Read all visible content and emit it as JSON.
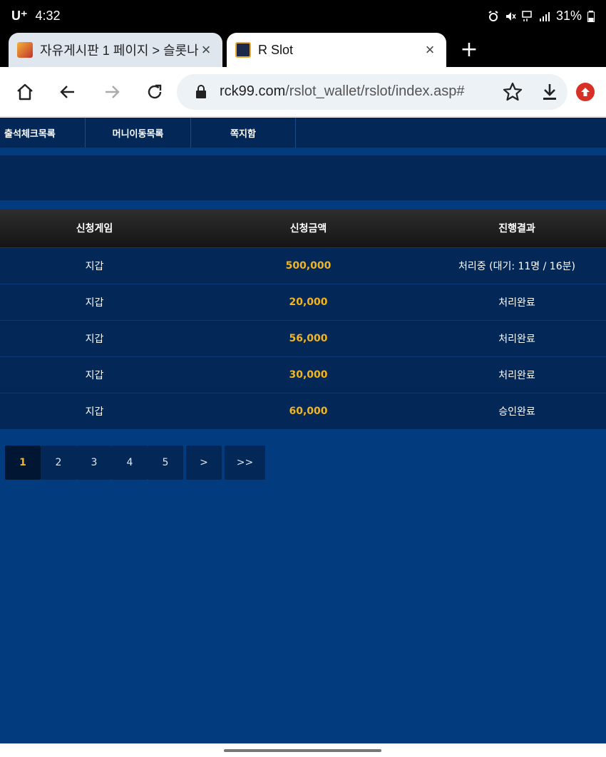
{
  "status": {
    "carrier": "U⁺",
    "time": "4:32",
    "battery": "31%"
  },
  "tabs": [
    {
      "title": "자유게시판 1 페이지 > 슬롯나라",
      "active": false
    },
    {
      "title": "R Slot",
      "active": true
    }
  ],
  "toolbar": {
    "url_host": "rck99.com",
    "url_path": "/rslot_wallet/rslot/index.asp#"
  },
  "subnav": [
    "출석체크목록",
    "머니이동목록",
    "쪽지함"
  ],
  "table": {
    "headers": [
      "신청게임",
      "신청금액",
      "진행결과"
    ],
    "rows": [
      {
        "game": "지갑",
        "amount": "500,000",
        "result": "처리중 (대기: 11명 / 16분)"
      },
      {
        "game": "지갑",
        "amount": "20,000",
        "result": "처리완료"
      },
      {
        "game": "지갑",
        "amount": "56,000",
        "result": "처리완료"
      },
      {
        "game": "지갑",
        "amount": "30,000",
        "result": "처리완료"
      },
      {
        "game": "지갑",
        "amount": "60,000",
        "result": "승인완료"
      }
    ]
  },
  "pager": {
    "pages": [
      "1",
      "2",
      "3",
      "4",
      "5"
    ],
    "current": "1",
    "next": ">",
    "last": ">>"
  },
  "colors": {
    "page_bg": "#023c7e",
    "panel_bg": "#032757",
    "amount": "#f2b51f"
  }
}
